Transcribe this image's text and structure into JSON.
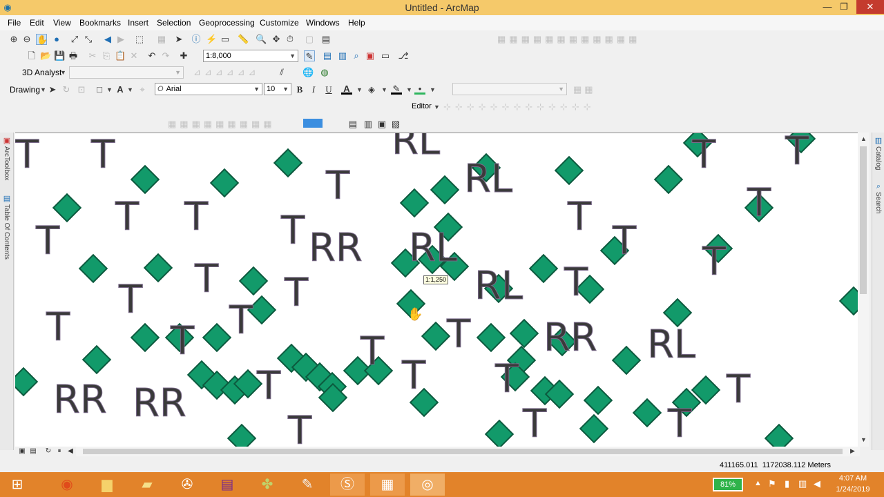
{
  "window": {
    "title": "Untitled - ArcMap"
  },
  "menus": [
    "File",
    "Edit",
    "View",
    "Bookmarks",
    "Insert",
    "Selection",
    "Geoprocessing",
    "Customize",
    "Windows",
    "Help"
  ],
  "standard_toolbar": {
    "scale": "1:8,000"
  },
  "analyst_toolbar": {
    "label": "3D Analyst"
  },
  "drawing_toolbar": {
    "label": "Drawing",
    "font": "Arial",
    "size": "10",
    "bold": "B",
    "italic": "I",
    "underline": "U",
    "font_color": "A"
  },
  "editor_toolbar": {
    "label": "Editor"
  },
  "left_dock": {
    "arctoolbox": "ArcToolbox",
    "toc": "Table Of Contents"
  },
  "right_dock": {
    "catalog": "Catalog",
    "search": "Search"
  },
  "map": {
    "tooltip": "1:1,250",
    "labels": [
      "T",
      "RL",
      "RR"
    ]
  },
  "status": {
    "coordinates": "411165.011  1172038.112 Meters"
  },
  "taskbar": {
    "battery": "81%",
    "time": "4:07 AM",
    "date": "1/24/2019"
  },
  "colors": {
    "titlebar": "#f5c96a",
    "taskbar": "#e2832a",
    "marker": "#129a6a",
    "label": "#3a3a3a"
  }
}
